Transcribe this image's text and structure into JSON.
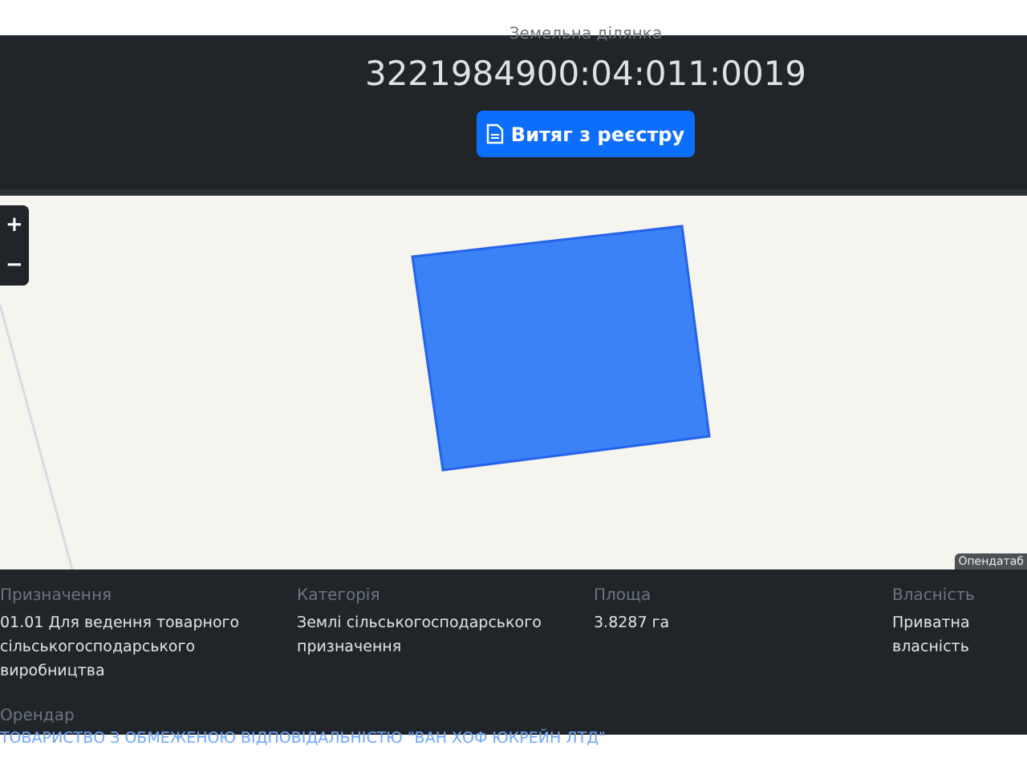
{
  "header": {
    "label": "Земельна ділянка",
    "cadastral_number": "3221984900:04:011:0019",
    "extract_button": "Витяг з реєстру"
  },
  "map": {
    "zoom_in": "+",
    "zoom_out": "−",
    "attribution": "Опендатаб"
  },
  "details": [
    {
      "label": "Призначення",
      "value": "01.01 Для ведення товарного сільськогосподарського виробництва"
    },
    {
      "label": "Категорія",
      "value": "Землі сільськогосподарського призначення"
    },
    {
      "label": "Площа",
      "value": "3.8287 га"
    },
    {
      "label": "Власність",
      "value": "Приватна власність"
    }
  ],
  "tenant": {
    "label": "Орендар",
    "value": "ТОВАРИСТВО З ОБМЕЖЕНОЮ ВІДПОВІДАЛЬНІСТЮ \"ВАН ХОФ ЮКРЕЙН ЛТД\""
  }
}
